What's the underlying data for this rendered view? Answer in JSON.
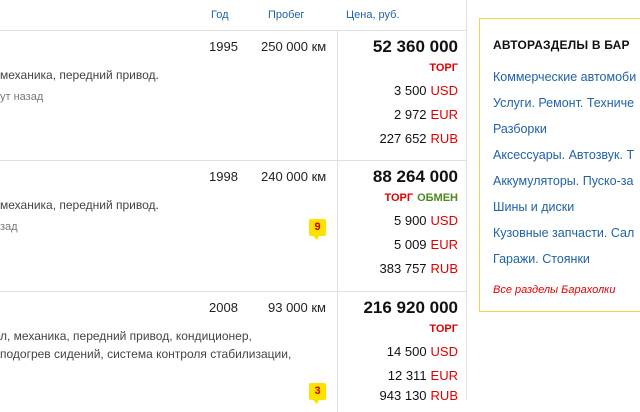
{
  "header": {
    "year": "Год",
    "mileage": "Пробег",
    "price": "Цена, руб."
  },
  "listings": [
    {
      "year": "1995",
      "mileage": "250 000 км",
      "desc_lines": [
        "механика, передний привод."
      ],
      "ago": "ут назад",
      "price": "52 360 000",
      "torg": "ТОРГ",
      "obmen": "",
      "usd": "3 500",
      "usd_cur": "USD",
      "eur": "2 972",
      "eur_cur": "EUR",
      "rub": "227 652",
      "rub_cur": "RUB",
      "badge": ""
    },
    {
      "year": "1998",
      "mileage": "240 000 км",
      "desc_lines": [
        "механика, передний привод."
      ],
      "ago": "зад",
      "price": "88 264 000",
      "torg": "ТОРГ",
      "obmen": "ОБМЕН",
      "usd": "5 900",
      "usd_cur": "USD",
      "eur": "5 009",
      "eur_cur": "EUR",
      "rub": "383 757",
      "rub_cur": "RUB",
      "badge": "9"
    },
    {
      "year": "2008",
      "mileage": "93 000 км",
      "desc_lines": [
        "л, механика, передний привод, кондиционер,",
        "подогрев сидений, система контроля стабилизации,"
      ],
      "ago": "",
      "price": "216 920 000",
      "torg": "ТОРГ",
      "obmen": "",
      "usd": "14 500",
      "usd_cur": "USD",
      "eur": "12 311",
      "eur_cur": "EUR",
      "rub": "943 130",
      "rub_cur": "RUB",
      "badge": "3"
    }
  ],
  "sidebar": {
    "title": "АВТОРАЗДЕЛЫ В БАР",
    "links": [
      "Коммерческие автомоби",
      "Услуги. Ремонт. Техниче",
      "Разборки",
      "Аксессуары. Автозвук. Т",
      "Аккумуляторы. Пуско-за",
      "Шины и диски",
      "Кузовные запчасти. Сал",
      "Гаражи. Стоянки"
    ],
    "all_link": "Все разделы Барахолки"
  },
  "colors": {
    "link": "#2163a5",
    "accent_red": "#e00000",
    "accent_green": "#4a8a1c",
    "badge_bg": "#ffe100",
    "sidebar_border": "#f3d34a"
  }
}
